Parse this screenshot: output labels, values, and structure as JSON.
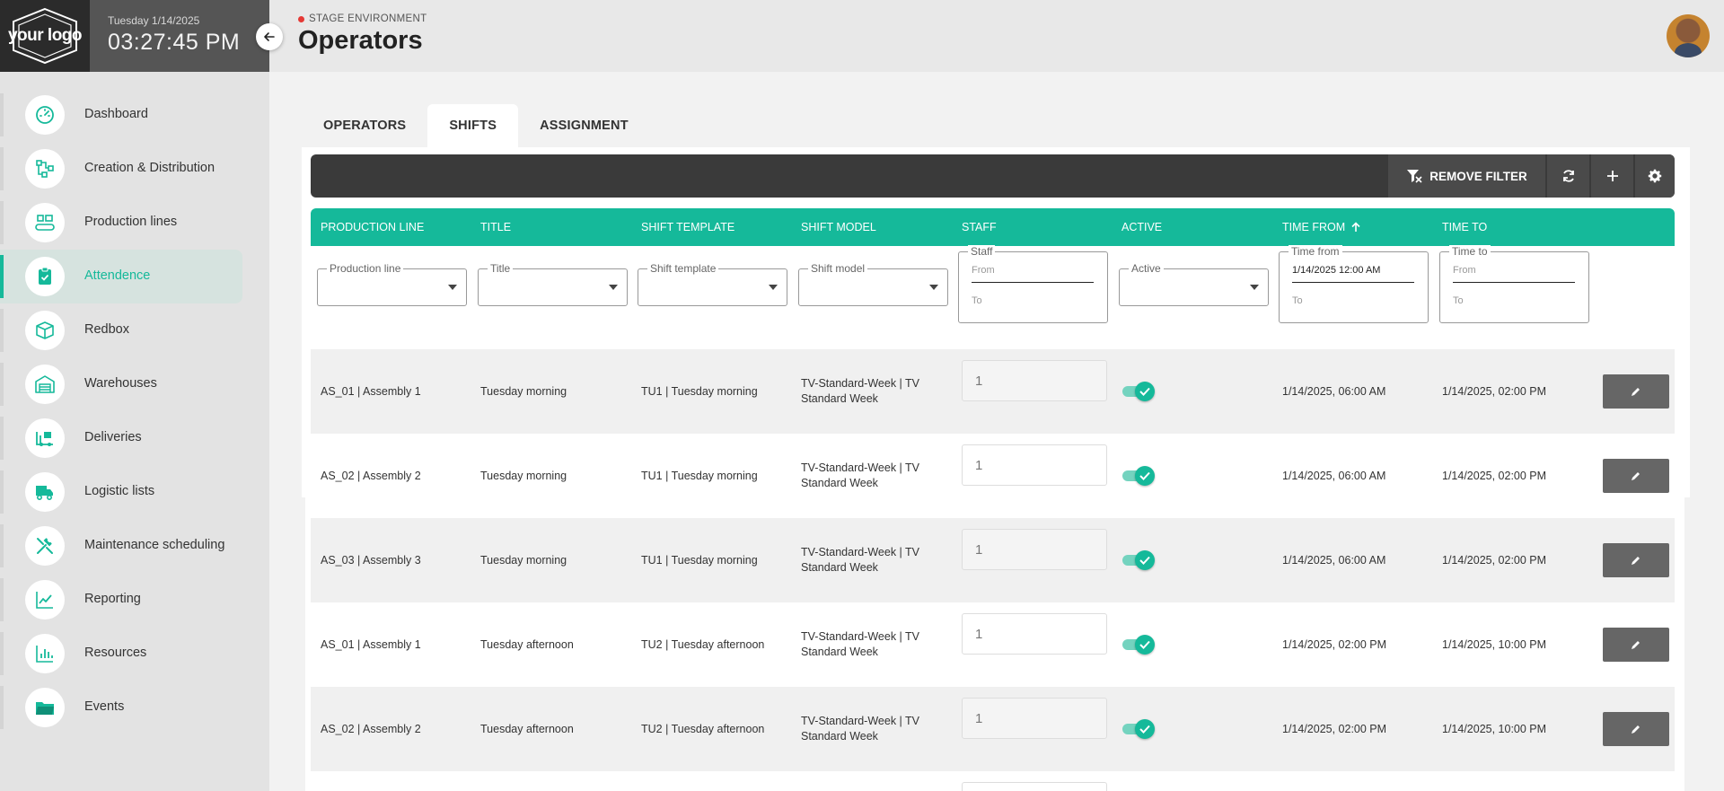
{
  "brand": {
    "logo_text": "your logo",
    "date": "Tuesday 1/14/2025",
    "time": "03:27:45 PM"
  },
  "header": {
    "environment": "STAGE ENVIRONMENT",
    "title": "Operators"
  },
  "sidebar": {
    "items": [
      {
        "label": "Dashboard",
        "icon": "gauge-icon"
      },
      {
        "label": "Creation & Distribution",
        "icon": "flow-icon"
      },
      {
        "label": "Production lines",
        "icon": "conveyor-icon"
      },
      {
        "label": "Attendence",
        "icon": "clipboard-check-icon",
        "active": true
      },
      {
        "label": "Redbox",
        "icon": "box-icon"
      },
      {
        "label": "Warehouses",
        "icon": "warehouse-icon"
      },
      {
        "label": "Deliveries",
        "icon": "forklift-icon"
      },
      {
        "label": "Logistic lists",
        "icon": "truck-icon"
      },
      {
        "label": "Maintenance scheduling",
        "icon": "tools-icon"
      },
      {
        "label": "Reporting",
        "icon": "trend-chart-icon"
      },
      {
        "label": "Resources",
        "icon": "bar-chart-icon"
      },
      {
        "label": "Events",
        "icon": "folder-icon"
      }
    ]
  },
  "tabs": [
    {
      "label": "OPERATORS"
    },
    {
      "label": "SHIFTS",
      "active": true
    },
    {
      "label": "ASSIGNMENT"
    }
  ],
  "toolbar": {
    "remove_filter": "REMOVE FILTER"
  },
  "table": {
    "columns": [
      "PRODUCTION LINE",
      "TITLE",
      "SHIFT TEMPLATE",
      "SHIFT MODEL",
      "STAFF",
      "ACTIVE",
      "TIME FROM",
      "TIME TO"
    ],
    "sorted_column": "TIME FROM",
    "sort_direction": "ascending",
    "filters": {
      "production_line": "Production line",
      "title": "Title",
      "shift_template": "Shift template",
      "shift_model": "Shift model",
      "staff": {
        "label": "Staff",
        "from": "From",
        "to": "To"
      },
      "active": "Active",
      "time_from": {
        "label": "Time from",
        "from": "1/14/2025 12:00 AM",
        "to": "To"
      },
      "time_to": {
        "label": "Time to",
        "from": "From",
        "to": "To"
      }
    },
    "rows": [
      {
        "production_line": "AS_01 | Assembly 1",
        "title": "Tuesday morning",
        "shift_template": "TU1 | Tuesday morning",
        "shift_model_1": "TV-Standard-Week | TV",
        "shift_model_2": "Standard Week",
        "staff": "1",
        "active": true,
        "time_from": "1/14/2025, 06:00 AM",
        "time_to": "1/14/2025, 02:00 PM"
      },
      {
        "production_line": "AS_02 | Assembly 2",
        "title": "Tuesday morning",
        "shift_template": "TU1 | Tuesday morning",
        "shift_model_1": "TV-Standard-Week | TV",
        "shift_model_2": "Standard Week",
        "staff": "1",
        "active": true,
        "time_from": "1/14/2025, 06:00 AM",
        "time_to": "1/14/2025, 02:00 PM"
      },
      {
        "production_line": "AS_03 | Assembly 3",
        "title": "Tuesday morning",
        "shift_template": "TU1 | Tuesday morning",
        "shift_model_1": "TV-Standard-Week | TV",
        "shift_model_2": "Standard Week",
        "staff": "1",
        "active": true,
        "time_from": "1/14/2025, 06:00 AM",
        "time_to": "1/14/2025, 02:00 PM"
      },
      {
        "production_line": "AS_01 | Assembly 1",
        "title": "Tuesday afternoon",
        "shift_template": "TU2 | Tuesday afternoon",
        "shift_model_1": "TV-Standard-Week | TV",
        "shift_model_2": "Standard Week",
        "staff": "1",
        "active": true,
        "time_from": "1/14/2025, 02:00 PM",
        "time_to": "1/14/2025, 10:00 PM"
      },
      {
        "production_line": "AS_02 | Assembly 2",
        "title": "Tuesday afternoon",
        "shift_template": "TU2 | Tuesday afternoon",
        "shift_model_1": "TV-Standard-Week | TV",
        "shift_model_2": "Standard Week",
        "staff": "1",
        "active": true,
        "time_from": "1/14/2025, 02:00 PM",
        "time_to": "1/14/2025, 10:00 PM"
      }
    ]
  },
  "colors": {
    "accent": "#15b99a",
    "toolbar": "#3a3a3a",
    "sidebar_bg": "#e3e3e3",
    "brand_bg": "#2b2b2b",
    "env_dot": "#e53935"
  }
}
